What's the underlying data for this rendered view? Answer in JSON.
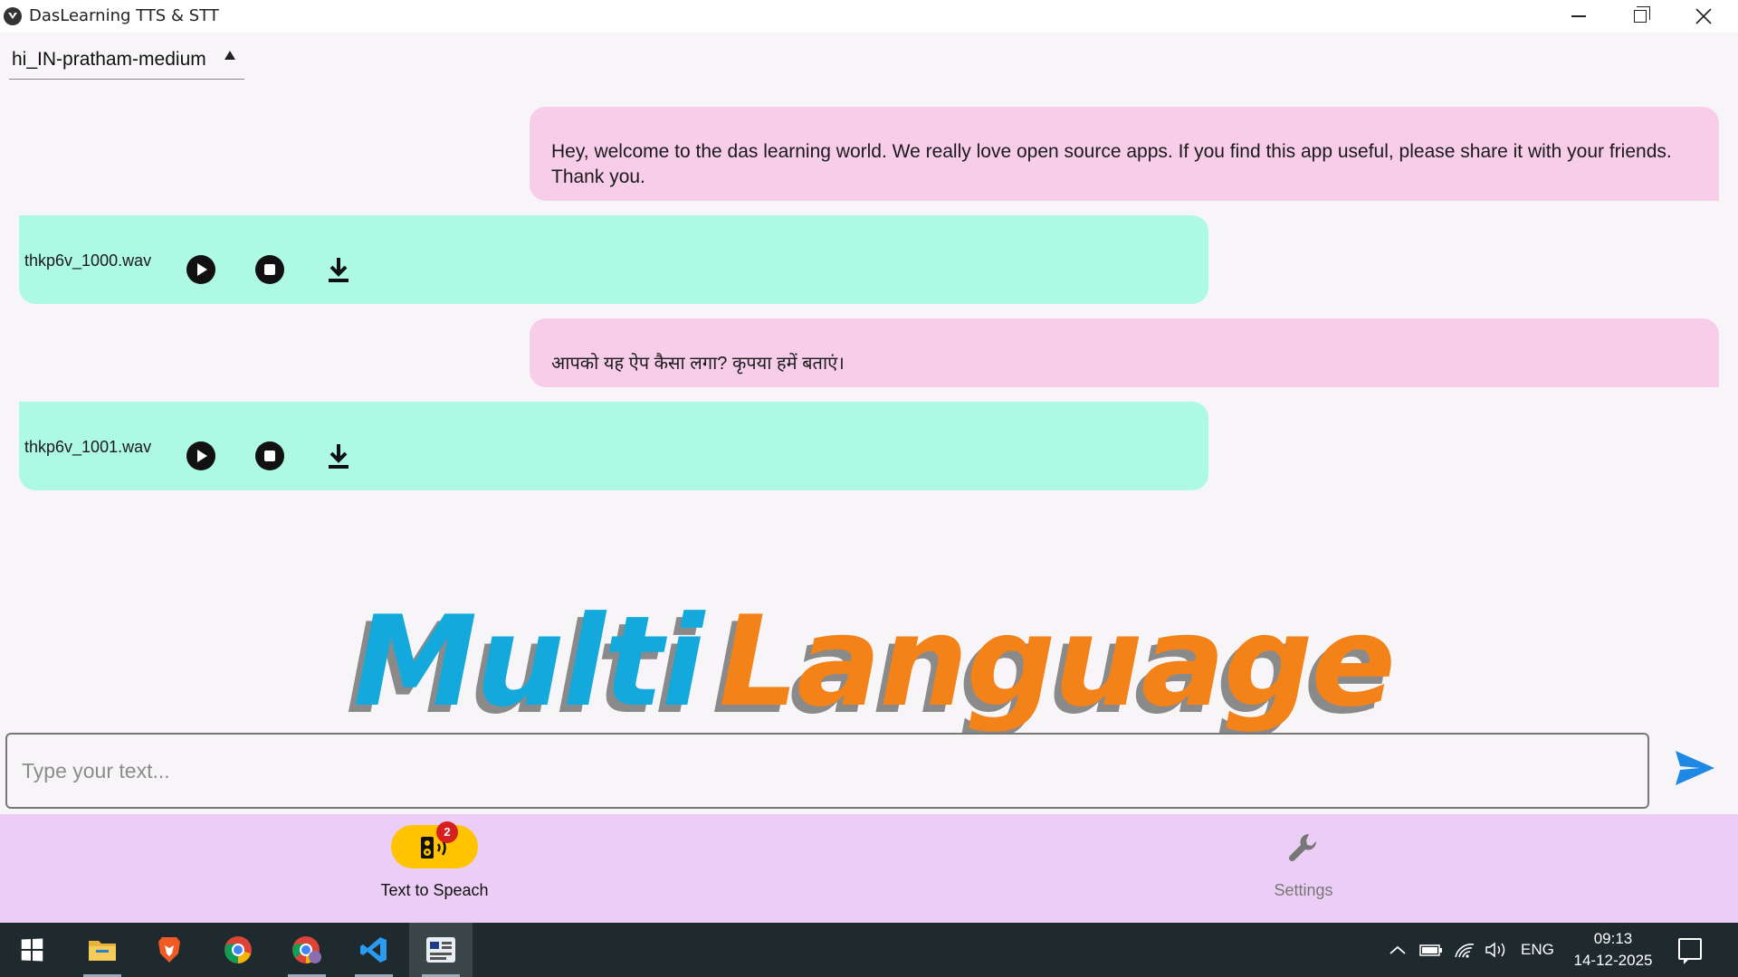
{
  "window": {
    "title": "DasLearning TTS & STT"
  },
  "voice": {
    "selected": "hi_IN-pratham-medium"
  },
  "messages": [
    {
      "role": "user",
      "text": "Hey, welcome to the das learning world. We really love open source apps. If you find this app useful, please share it with your friends. Thank you."
    },
    {
      "role": "audio",
      "file": "thkp6v_1000.wav"
    },
    {
      "role": "user",
      "text": "आपको यह ऐप कैसा लगा? कृपया हमें बताएं।"
    },
    {
      "role": "audio",
      "file": "thkp6v_1001.wav"
    }
  ],
  "banner": {
    "word1": "Multi",
    "word2": "Language",
    "colors": {
      "word1": "#14a9dc",
      "word2": "#f38218",
      "shadow": "#8a8a8a"
    }
  },
  "input": {
    "placeholder": "Type your text...",
    "value": ""
  },
  "nav": {
    "tts_label": "Text to Speach",
    "tts_badge": "2",
    "settings_label": "Settings"
  },
  "taskbar": {
    "apps": [
      "start-icon",
      "file-explorer-icon",
      "brave-icon",
      "chrome-icon",
      "chrome-profile-icon",
      "vscode-icon",
      "tts-app-icon"
    ],
    "language": "ENG",
    "time": "09:13",
    "date": "14-12-2025"
  },
  "colors": {
    "user_bubble": "#f8cdea",
    "audio_bubble": "#aef9e3",
    "nav_bg": "#ebcdf6",
    "nav_active": "#ffc300",
    "send": "#1e88e5"
  }
}
